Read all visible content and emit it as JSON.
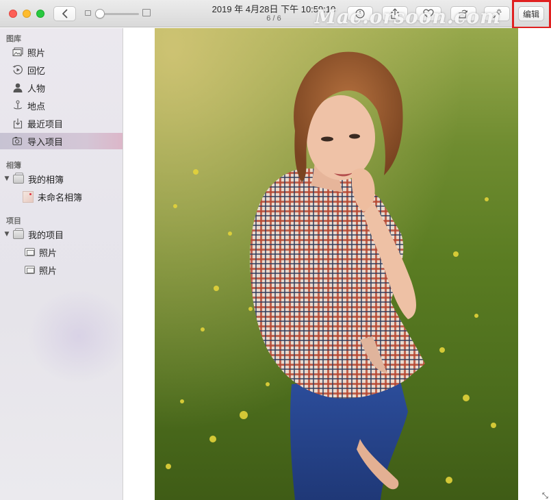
{
  "window": {
    "title_date": "2019 年 4月28日 下午 10:59:10",
    "photo_position": "6 / 6",
    "watermark": "Mac.orsoon.com"
  },
  "toolbar": {
    "edit_label": "编辑"
  },
  "sidebar": {
    "library_title": "图库",
    "library_items": [
      {
        "label": "照片",
        "icon": "photos-icon"
      },
      {
        "label": "回忆",
        "icon": "memories-icon"
      },
      {
        "label": "人物",
        "icon": "people-icon"
      },
      {
        "label": "地点",
        "icon": "places-icon"
      },
      {
        "label": "最近项目",
        "icon": "recent-icon"
      },
      {
        "label": "导入项目",
        "icon": "imports-icon",
        "selected": true
      }
    ],
    "albums_title": "相簿",
    "my_albums": "我的相簿",
    "album_items": [
      {
        "label": "未命名相簿"
      }
    ],
    "projects_title": "项目",
    "my_projects": "我的项目",
    "project_items": [
      {
        "label": "照片"
      },
      {
        "label": "照片"
      }
    ]
  },
  "colors": {
    "highlight_border": "#e02020",
    "selection": "#d4c6d6"
  }
}
